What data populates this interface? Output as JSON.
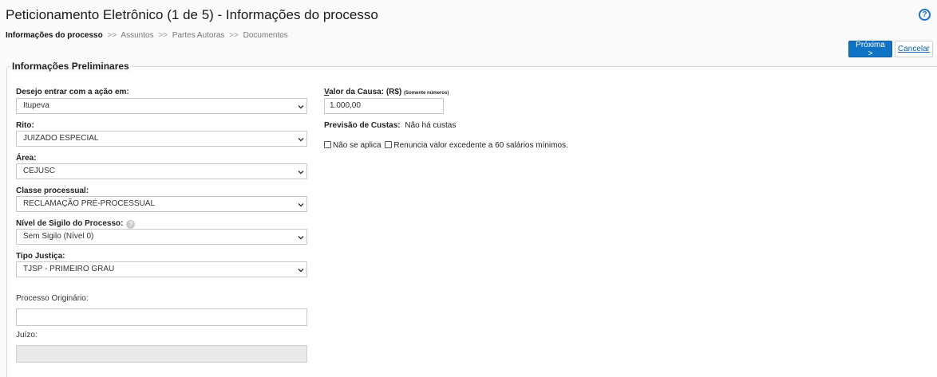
{
  "header": {
    "title": "Peticionamento Eletrônico (1 de 5) - Informações do processo",
    "help_icon": "question-circle-icon",
    "help_glyph": "?"
  },
  "breadcrumb": {
    "current": "Informações do processo",
    "separator": ">>",
    "steps": [
      "Assuntos",
      "Partes Autoras",
      "Documentos"
    ]
  },
  "actions": {
    "next_label": "Próxima >",
    "cancel_label": "Cancelar"
  },
  "form": {
    "legend": "Informações Preliminares",
    "foro": {
      "label": "Desejo entrar com a ação em:",
      "value": "Itupeva"
    },
    "rito": {
      "label": "Rito:",
      "value": "JUIZADO ESPECIAL"
    },
    "area": {
      "label": "Área:",
      "value": "CEJUSC"
    },
    "classe": {
      "label": "Classe processual:",
      "value": "RECLAMAÇÃO PRÉ-PROCESSUAL"
    },
    "sigilo": {
      "label": "Nível de Sigilo do Processo:",
      "value": "Sem Sigilo (Nível 0)",
      "help_glyph": "?"
    },
    "tipo_justica": {
      "label": "Tipo Justiça:",
      "value": "TJSP - PRIMEIRO GRAU"
    },
    "processo_originario": {
      "label": "Processo Originário:",
      "value": ""
    },
    "juizo": {
      "label": "Juízo:",
      "value": ""
    },
    "valor_causa": {
      "label_first": "V",
      "label_rest": "alor da Causa: (R$)",
      "note": "(Somente números)",
      "value": "1.000,00"
    },
    "previsao": {
      "label": "Previsão de Custas:",
      "value": "Não há custas"
    },
    "nao_se_aplica": {
      "label": "Não se aplica",
      "checked": false
    },
    "renuncia": {
      "label": "Renuncia valor excedente a 60 salários mínimos.",
      "checked": false
    }
  },
  "colors": {
    "primary": "#0f72c4",
    "link": "#1a73c8",
    "disabled": "#e9e9e9"
  }
}
